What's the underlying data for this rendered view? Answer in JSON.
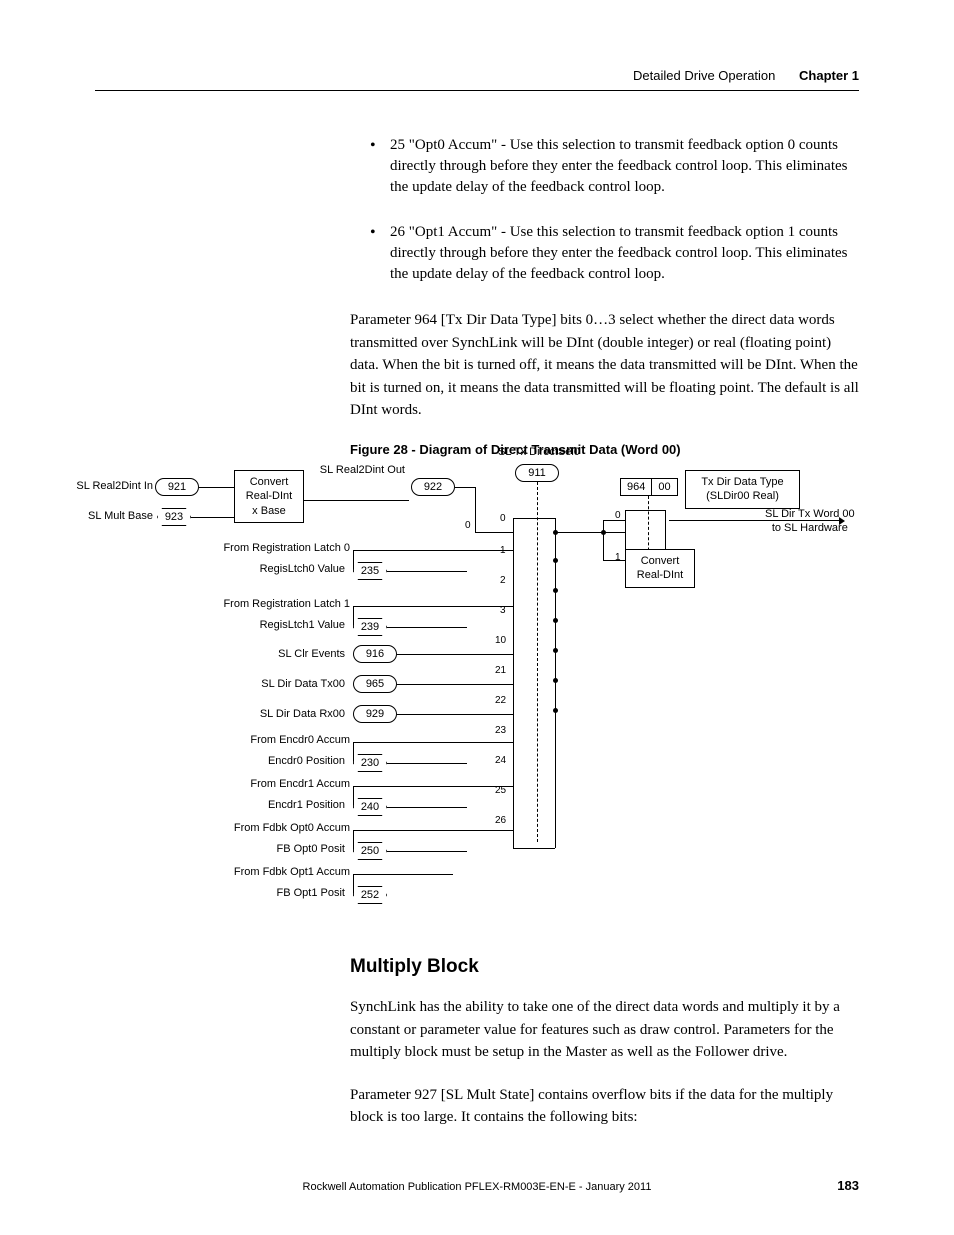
{
  "header": {
    "section": "Detailed Drive Operation",
    "chapter": "Chapter 1"
  },
  "bullets": [
    "25 \"Opt0 Accum\" - Use this selection to transmit feedback option 0 counts directly through before they enter the feedback control loop. This eliminates the update delay of the feedback control loop.",
    "26 \"Opt1 Accum\" - Use this selection to transmit feedback option 1 counts directly through before they enter the feedback control loop. This eliminates the update delay of the feedback control loop."
  ],
  "para1": "Parameter 964 [Tx Dir Data Type] bits 0…3 select whether the direct data words transmitted over SynchLink will be DInt (double integer) or real (floating point) data. When the bit is turned off, it means the data transmitted will be DInt. When the bit is turned on, it means the data transmitted will be floating point. The default is all DInt words.",
  "fig_caption": "Figure 28 - Diagram of Direct Transmit Data (Word 00)",
  "diagram": {
    "top_label": "SL Tx DirectSel0",
    "top_param": "911",
    "real2dint_out": "SL Real2Dint Out",
    "real2dint_out_param": "922",
    "real2dint_in": "SL Real2Dint In",
    "real2dint_in_param": "921",
    "mult_base": "SL Mult Base",
    "mult_base_param": "923",
    "convert_box": "Convert\nReal-DInt\nx Base",
    "tx_dir_type": "Tx Dir Data Type\n(SLDir00 Real)",
    "tx_dir_param": "964",
    "tx_dir_bit": "00",
    "convert_box2": "Convert\nReal-DInt",
    "output_label": "SL Dir Tx Word 00\nto SL Hardware",
    "left_items": [
      {
        "label": "From Registration Latch 0",
        "sub": "RegisLtch0 Value",
        "param": "235",
        "type": "diamond"
      },
      {
        "label": "From Registration Latch 1",
        "sub": "RegisLtch1 Value",
        "param": "239",
        "type": "diamond"
      },
      {
        "label": "",
        "sub": "SL Clr Events",
        "param": "916",
        "type": "round"
      },
      {
        "label": "",
        "sub": "SL Dir Data Tx00",
        "param": "965",
        "type": "round"
      },
      {
        "label": "",
        "sub": "SL Dir Data Rx00",
        "param": "929",
        "type": "round"
      },
      {
        "label": "From Encdr0 Accum",
        "sub": "Encdr0 Position",
        "param": "230",
        "type": "diamond"
      },
      {
        "label": "From Encdr1 Accum",
        "sub": "Encdr1 Position",
        "param": "240",
        "type": "diamond"
      },
      {
        "label": "From Fdbk Opt0 Accum",
        "sub": "FB Opt0 Posit",
        "param": "250",
        "type": "diamond"
      },
      {
        "label": "From Fdbk Opt1 Accum",
        "sub": "FB Opt1 Posit",
        "param": "252",
        "type": "diamond"
      }
    ],
    "mux_nums": [
      "0",
      "1",
      "2",
      "3",
      "10",
      "21",
      "22",
      "23",
      "24",
      "25",
      "26"
    ],
    "mux2_nums": [
      "0",
      "1"
    ],
    "mux1_zero": "0"
  },
  "section2_heading": "Multiply Block",
  "section2_p1": "SynchLink has the ability to take one of the direct data words and multiply it by a constant or parameter value for features such as draw control. Parameters for the multiply block must be setup in the Master as well as the Follower drive.",
  "section2_p2": "Parameter 927 [SL Mult State] contains overflow bits if the data for the multiply block is too large. It contains the following bits:",
  "footer": "Rockwell Automation Publication PFLEX-RM003E-EN-E - January 2011",
  "page_num": "183"
}
